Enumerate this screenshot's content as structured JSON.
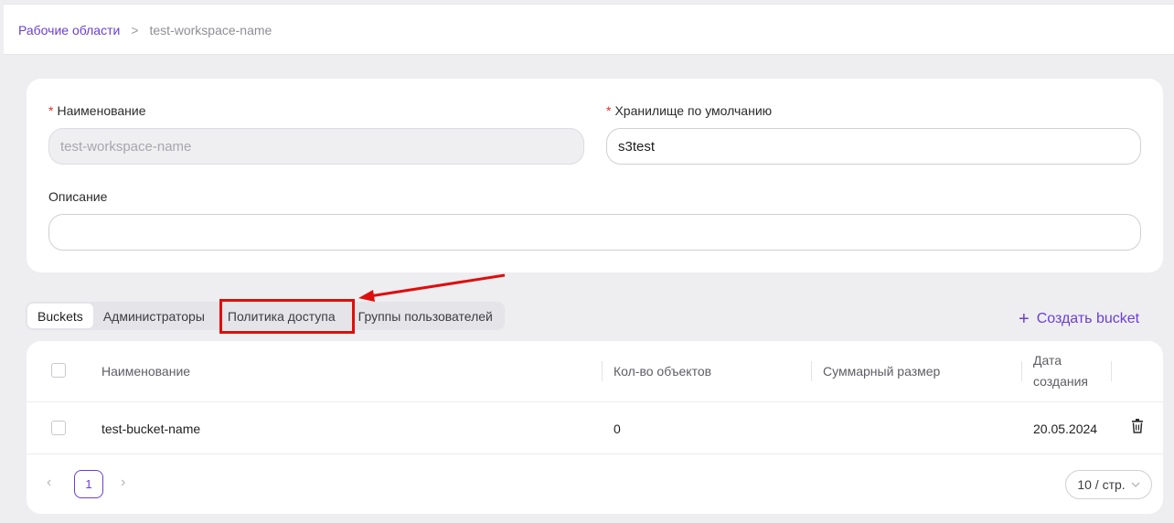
{
  "breadcrumb": {
    "root": "Рабочие области",
    "separator": ">",
    "current": "test-workspace-name"
  },
  "form": {
    "name_label": "Наименование",
    "name_value": "test-workspace-name",
    "storage_label": "Хранилище по умолчанию",
    "storage_value": "s3test",
    "description_label": "Описание",
    "description_value": "",
    "required_mark": "*"
  },
  "tabs": [
    {
      "label": "Buckets",
      "active": true
    },
    {
      "label": "Администраторы",
      "active": false
    },
    {
      "label": "Политика доступа",
      "active": false
    },
    {
      "label": "Группы пользователей",
      "active": false
    }
  ],
  "actions": {
    "create_bucket_label": "Создать bucket",
    "create_icon": "plus-icon"
  },
  "table": {
    "headers": {
      "name": "Наименование",
      "objects": "Кол-во объектов",
      "size": "Суммарный размер",
      "date_line1": "Дата",
      "date_line2": "создания"
    },
    "rows": [
      {
        "name": "test-bucket-name",
        "objects": "0",
        "size": "",
        "date": "20.05.2024",
        "action_icon": "trash-icon"
      }
    ]
  },
  "pagination": {
    "current_page": "1",
    "page_size": "10 / стр.",
    "prev_icon": "chevron-left-icon",
    "next_icon": "chevron-right-icon"
  },
  "colors": {
    "accent": "#6a3fd6",
    "highlight": "#e00d0d"
  }
}
